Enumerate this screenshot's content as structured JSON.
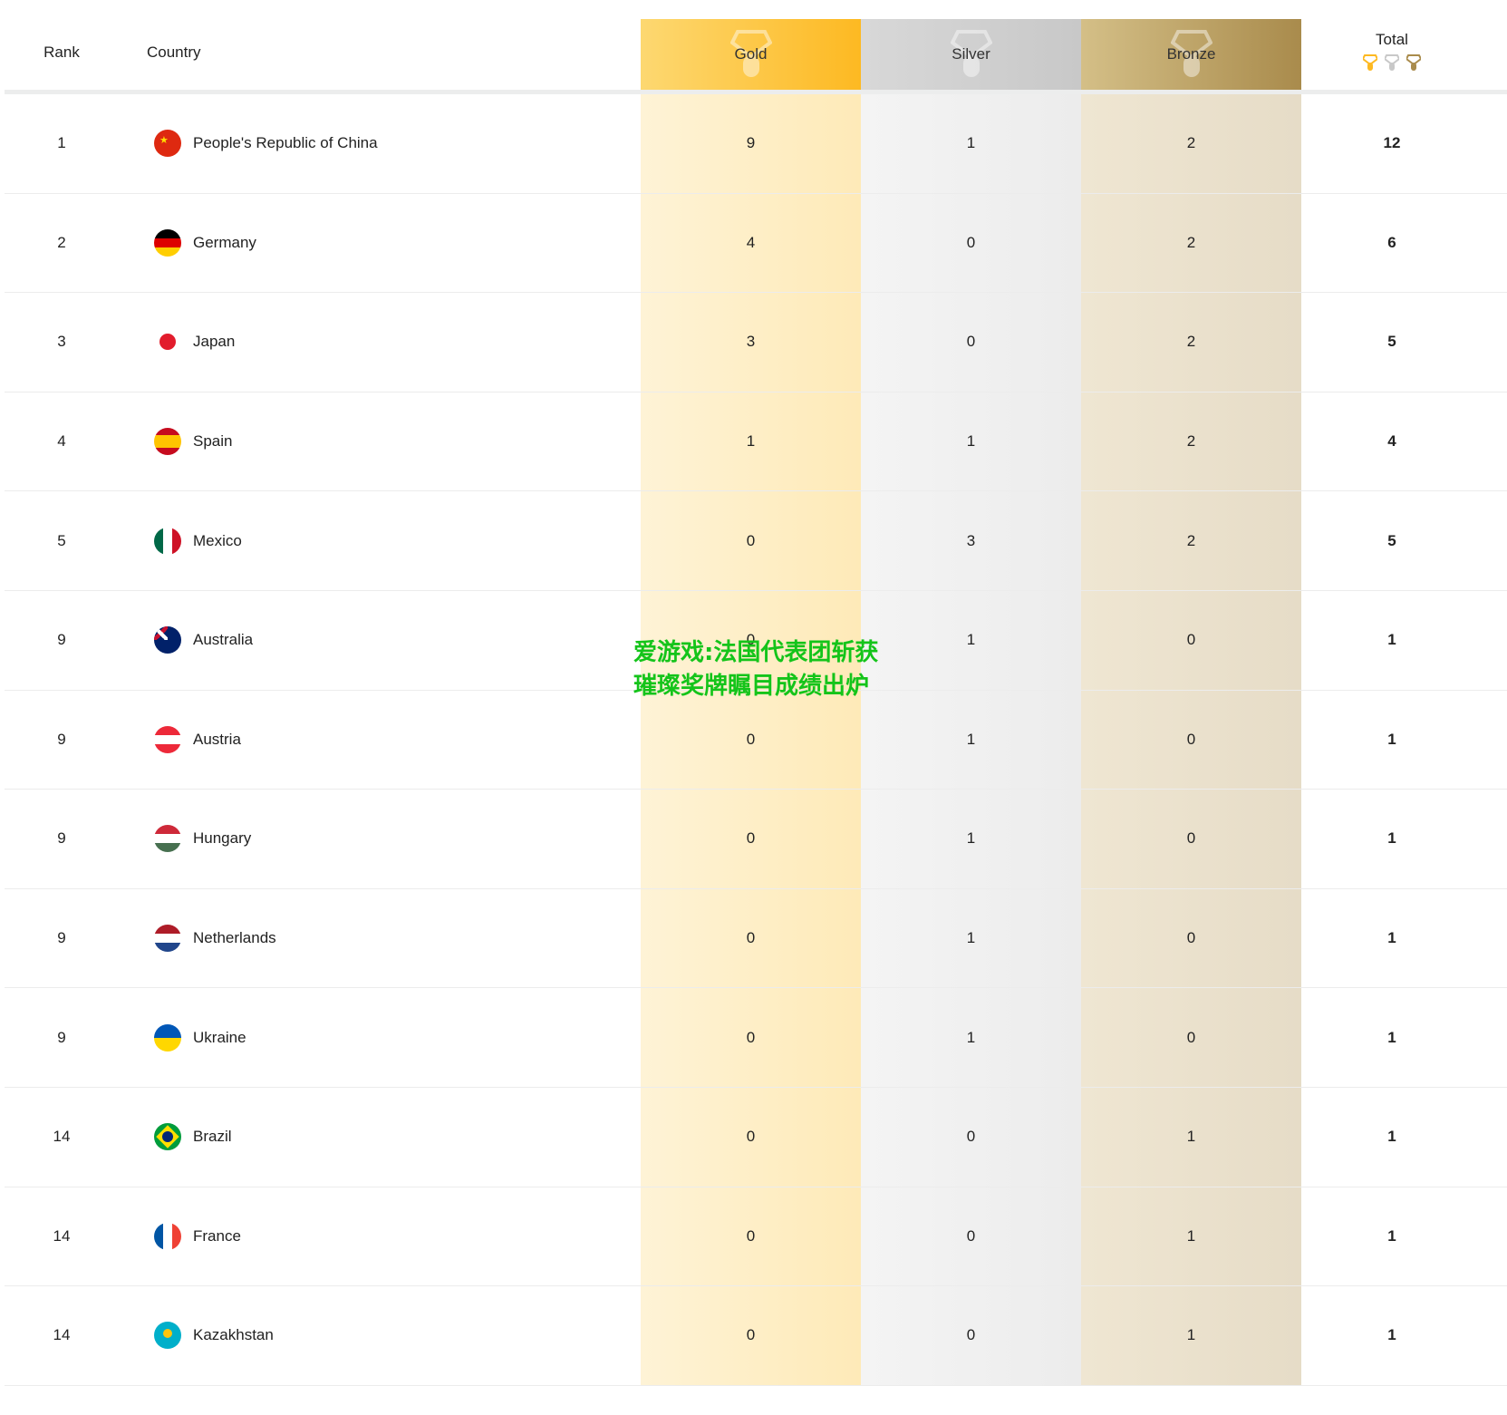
{
  "header": {
    "rank": "Rank",
    "country": "Country",
    "gold": "Gold",
    "silver": "Silver",
    "bronze": "Bronze",
    "total": "Total"
  },
  "colors": {
    "gold": "#fdb922",
    "silver": "#c8c8c8",
    "bronze": "#a98b4c",
    "watermark": "#14c41a"
  },
  "rows": [
    {
      "rank": "1",
      "country": "People's Republic of China",
      "flag": "china",
      "gold": "9",
      "silver": "1",
      "bronze": "2",
      "total": "12"
    },
    {
      "rank": "2",
      "country": "Germany",
      "flag": "germany",
      "gold": "4",
      "silver": "0",
      "bronze": "2",
      "total": "6"
    },
    {
      "rank": "3",
      "country": "Japan",
      "flag": "japan",
      "gold": "3",
      "silver": "0",
      "bronze": "2",
      "total": "5"
    },
    {
      "rank": "4",
      "country": "Spain",
      "flag": "spain",
      "gold": "1",
      "silver": "1",
      "bronze": "2",
      "total": "4"
    },
    {
      "rank": "5",
      "country": "Mexico",
      "flag": "mexico",
      "gold": "0",
      "silver": "3",
      "bronze": "2",
      "total": "5"
    },
    {
      "rank": "9",
      "country": "Australia",
      "flag": "australia",
      "gold": "0",
      "silver": "1",
      "bronze": "0",
      "total": "1"
    },
    {
      "rank": "9",
      "country": "Austria",
      "flag": "austria",
      "gold": "0",
      "silver": "1",
      "bronze": "0",
      "total": "1"
    },
    {
      "rank": "9",
      "country": "Hungary",
      "flag": "hungary",
      "gold": "0",
      "silver": "1",
      "bronze": "0",
      "total": "1"
    },
    {
      "rank": "9",
      "country": "Netherlands",
      "flag": "netherlands",
      "gold": "0",
      "silver": "1",
      "bronze": "0",
      "total": "1"
    },
    {
      "rank": "9",
      "country": "Ukraine",
      "flag": "ukraine",
      "gold": "0",
      "silver": "1",
      "bronze": "0",
      "total": "1"
    },
    {
      "rank": "14",
      "country": "Brazil",
      "flag": "brazil",
      "gold": "0",
      "silver": "0",
      "bronze": "1",
      "total": "1"
    },
    {
      "rank": "14",
      "country": "France",
      "flag": "france",
      "gold": "0",
      "silver": "0",
      "bronze": "1",
      "total": "1"
    },
    {
      "rank": "14",
      "country": "Kazakhstan",
      "flag": "kazakhstan",
      "gold": "0",
      "silver": "0",
      "bronze": "1",
      "total": "1"
    }
  ],
  "watermark": "爱游戏:法国代表团斩获璀璨奖牌瞩目成绩出炉"
}
